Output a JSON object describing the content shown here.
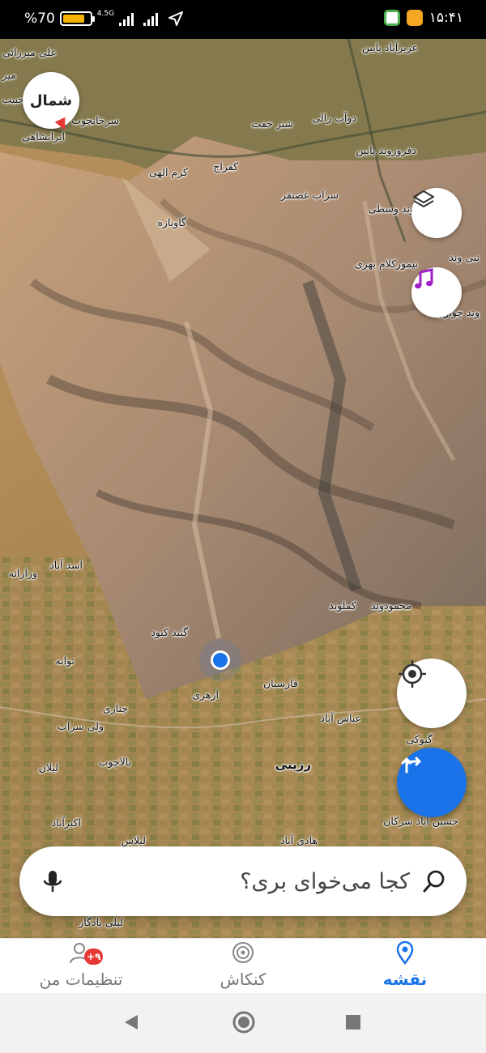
{
  "status_bar": {
    "battery_text": "%70",
    "network_type": "4.5G",
    "time": "۱۵:۴۱",
    "icons": [
      "battery-icon",
      "signal-icon",
      "signal-icon",
      "location-arrow-icon",
      "app-icon",
      "app-icon"
    ]
  },
  "map": {
    "compass_label": "شمال",
    "buttons": [
      "layers-icon",
      "music-icon",
      "my-location-icon",
      "navigation-icon"
    ],
    "places": [
      {
        "id": "p1",
        "name": "علی میرزائی"
      },
      {
        "id": "p2",
        "name": "میر"
      },
      {
        "id": "p3",
        "name": "حبیب"
      },
      {
        "id": "p4",
        "name": "عزیزآباد پایین"
      },
      {
        "id": "p5",
        "name": "سرخانچوب سفلی"
      },
      {
        "id": "p6",
        "name": "ایرانشاهی"
      },
      {
        "id": "p7",
        "name": "دوآب زالی"
      },
      {
        "id": "p8",
        "name": "شتر خفت"
      },
      {
        "id": "p9",
        "name": "دفروزوند پایین"
      },
      {
        "id": "p10",
        "name": "کرم الهی"
      },
      {
        "id": "p11",
        "name": "کفراج"
      },
      {
        "id": "p12",
        "name": "سراب غضنفر"
      },
      {
        "id": "p13",
        "name": "گاوبازه"
      },
      {
        "id": "p14",
        "name": "وند وسطی"
      },
      {
        "id": "p15",
        "name": "نبی وند"
      },
      {
        "id": "p16",
        "name": "تیمورکلام بهری"
      },
      {
        "id": "p17",
        "name": "وند چوارن"
      },
      {
        "id": "p18",
        "name": "اسد آباد"
      },
      {
        "id": "p19",
        "name": "وزارانه"
      },
      {
        "id": "p20",
        "name": "محمودوند"
      },
      {
        "id": "p21",
        "name": "کملوند"
      },
      {
        "id": "p22",
        "name": "گنبد کبود"
      },
      {
        "id": "p23",
        "name": "توانه"
      },
      {
        "id": "p24",
        "name": "فارسیان"
      },
      {
        "id": "p25",
        "name": "ازهری"
      },
      {
        "id": "p26",
        "name": "چناری"
      },
      {
        "id": "p27",
        "name": "عباس آباد"
      },
      {
        "id": "p28",
        "name": "ولی سراب"
      },
      {
        "id": "p29",
        "name": "گیوکی"
      },
      {
        "id": "p30",
        "name": "بالاچوب"
      },
      {
        "id": "p31",
        "name": "لیلان"
      },
      {
        "id": "p32",
        "name": "رزینی"
      },
      {
        "id": "p33",
        "name": "اکبرآباد"
      },
      {
        "id": "p34",
        "name": "حسین آباد سرکان"
      },
      {
        "id": "p35",
        "name": "لیلاس"
      },
      {
        "id": "p36",
        "name": "هادی آباد"
      },
      {
        "id": "p37",
        "name": "لیلی یادگار"
      }
    ]
  },
  "search": {
    "placeholder": "کجا می‌خوای بری؟",
    "left_icon": "microphone-icon",
    "right_icon": "search-icon"
  },
  "tabs": [
    {
      "label": "تنظیمات من",
      "icon": "user-icon",
      "badge": "+۹",
      "active": false
    },
    {
      "label": "کنکاش",
      "icon": "explore-icon",
      "active": false
    },
    {
      "label": "نقشه",
      "icon": "location-pin-icon",
      "active": true
    }
  ],
  "colors": {
    "accent": "#1a73e8",
    "badge": "#e53935",
    "music": "#a020c8"
  }
}
